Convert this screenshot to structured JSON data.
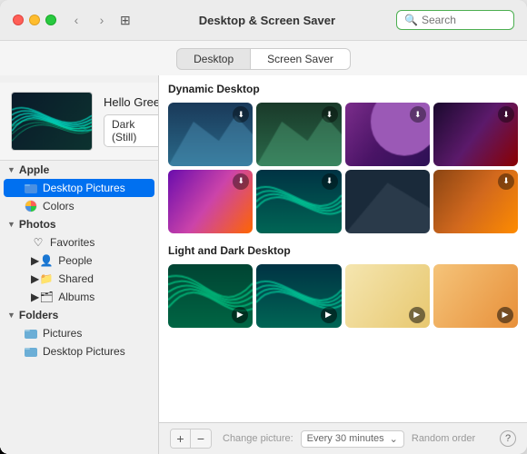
{
  "window": {
    "title": "Desktop & Screen Saver"
  },
  "tabs": [
    {
      "id": "desktop",
      "label": "Desktop",
      "active": true
    },
    {
      "id": "screensaver",
      "label": "Screen Saver",
      "active": false
    }
  ],
  "search": {
    "placeholder": "Search"
  },
  "preview": {
    "name": "Hello Green",
    "style": "Dark (Still)"
  },
  "sidebar": {
    "apple_section": "Apple",
    "desktop_pictures": "Desktop Pictures",
    "colors": "Colors",
    "photos_section": "Photos",
    "favorites": "Favorites",
    "people": "People",
    "shared": "Shared",
    "albums": "Albums",
    "folders_section": "Folders",
    "pictures": "Pictures",
    "folders_desktop": "Desktop Pictures"
  },
  "gallery": {
    "dynamic_title": "Dynamic Desktop",
    "light_dark_title": "Light and Dark Desktop"
  },
  "bottom": {
    "change_picture_label": "Change picture:",
    "change_picture_value": "Every 30 minutes",
    "random_order_label": "Random order",
    "help_label": "?"
  },
  "colors": {
    "selected_blue": "#0070f0",
    "green_arrow": "#2ecc40",
    "download_badge": "rgba(0,0,0,0.45)"
  }
}
